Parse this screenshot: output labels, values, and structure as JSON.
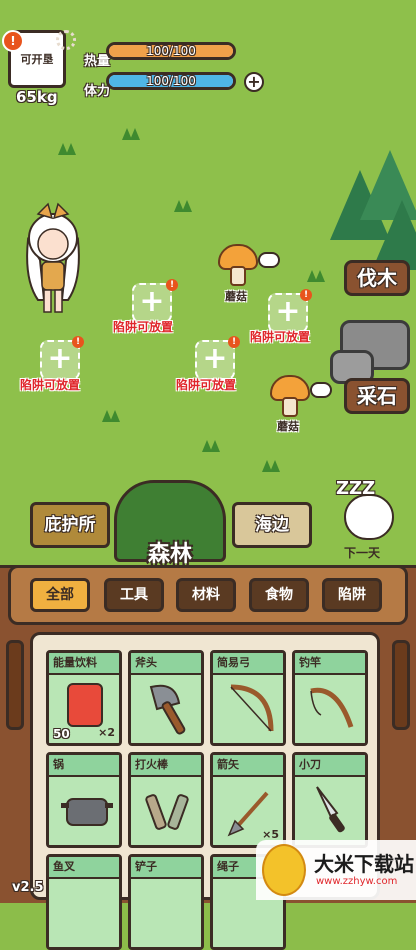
{
  "hud": {
    "planet_label": "可开垦",
    "weight": "65kg",
    "heat_label": "热量",
    "heat_value": "100/100",
    "heat_fill": 1.0,
    "stamina_label": "体力",
    "stamina_value": "100/100",
    "stamina_fill": 1.0,
    "alert": "!",
    "colors": {
      "heat": "#f0a14a",
      "stamina": "#4fb6e6"
    }
  },
  "field": {
    "traps": [
      {
        "label": "陷阱可放置"
      },
      {
        "label": "陷阱可放置"
      },
      {
        "label": "陷阱可放置"
      },
      {
        "label": "陷阱可放置"
      }
    ],
    "mushrooms": [
      {
        "label": "蘑菇"
      },
      {
        "label": "蘑菇"
      }
    ],
    "signs": {
      "chop": "伐木",
      "mine": "采石"
    }
  },
  "locations": {
    "shelter": "庇护所",
    "forest": "森林",
    "beach": "海边",
    "next_day": "下一天",
    "sleep": "ZZZ"
  },
  "categories": [
    {
      "label": "全部",
      "active": true
    },
    {
      "label": "工具",
      "active": false
    },
    {
      "label": "材料",
      "active": false
    },
    {
      "label": "食物",
      "active": false
    },
    {
      "label": "陷阱",
      "active": false
    }
  ],
  "items": [
    {
      "name": "能量饮料",
      "qty": "×2",
      "level": "50",
      "icon": "energy-drink-icon"
    },
    {
      "name": "斧头",
      "qty": "",
      "level": "",
      "icon": "axe-icon"
    },
    {
      "name": "简易弓",
      "qty": "",
      "level": "",
      "icon": "bow-icon"
    },
    {
      "name": "钓竿",
      "qty": "",
      "level": "",
      "icon": "fishing-rod-icon"
    },
    {
      "name": "锅",
      "qty": "",
      "level": "",
      "icon": "pot-icon"
    },
    {
      "name": "打火棒",
      "qty": "",
      "level": "",
      "icon": "fire-starter-icon"
    },
    {
      "name": "箭矢",
      "qty": "×5",
      "level": "",
      "icon": "arrow-icon"
    },
    {
      "name": "小刀",
      "qty": "",
      "level": "",
      "icon": "knife-icon"
    },
    {
      "name": "鱼叉",
      "qty": "",
      "level": "",
      "icon": "harpoon-icon"
    },
    {
      "name": "铲子",
      "qty": "",
      "level": "",
      "icon": "shovel-icon"
    },
    {
      "name": "绳子",
      "qty": "",
      "level": "",
      "icon": "rope-icon"
    }
  ],
  "version": "v2.5",
  "watermark": {
    "title": "大米下载站",
    "url": "www.zzhyw.com"
  }
}
